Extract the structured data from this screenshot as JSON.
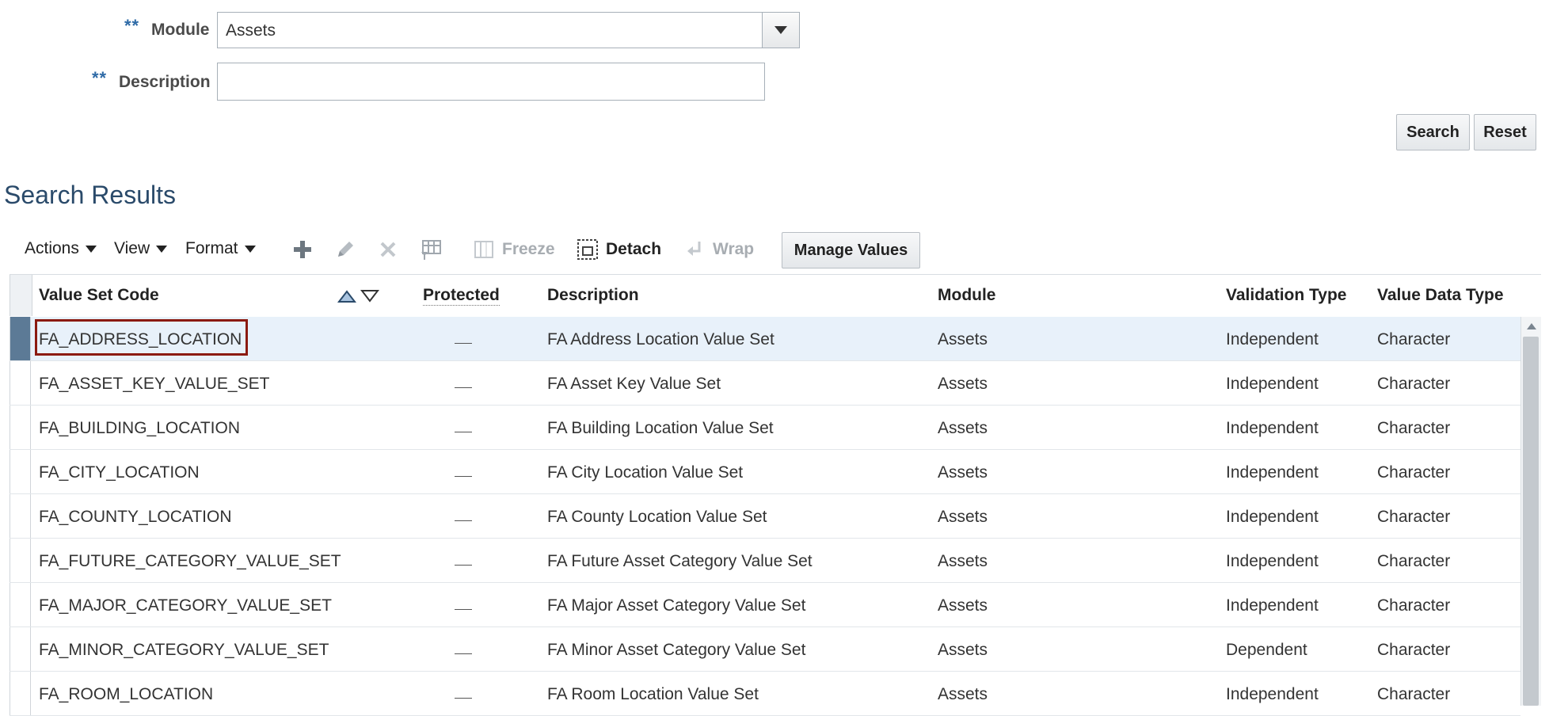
{
  "search_form": {
    "module_required_marker": "**",
    "module_label": "Module",
    "module_value": "Assets",
    "description_required_marker": "**",
    "description_label": "Description",
    "description_value": "",
    "search_button": "Search",
    "reset_button": "Reset"
  },
  "results": {
    "title": "Search Results",
    "toolbar": {
      "actions": "Actions",
      "view": "View",
      "format": "Format",
      "freeze": "Freeze",
      "detach": "Detach",
      "wrap": "Wrap",
      "manage_values": "Manage Values"
    },
    "columns": {
      "code": "Value Set Code",
      "protected": "Protected",
      "description": "Description",
      "module": "Module",
      "validation_type": "Validation Type",
      "data_type": "Value Data Type"
    },
    "rows": [
      {
        "code": "FA_ADDRESS_LOCATION",
        "protected": "—",
        "description": "FA Address Location Value Set",
        "module": "Assets",
        "validation_type": "Independent",
        "data_type": "Character"
      },
      {
        "code": "FA_ASSET_KEY_VALUE_SET",
        "protected": "—",
        "description": "FA Asset Key Value Set",
        "module": "Assets",
        "validation_type": "Independent",
        "data_type": "Character"
      },
      {
        "code": "FA_BUILDING_LOCATION",
        "protected": "—",
        "description": "FA Building Location Value Set",
        "module": "Assets",
        "validation_type": "Independent",
        "data_type": "Character"
      },
      {
        "code": "FA_CITY_LOCATION",
        "protected": "—",
        "description": "FA City Location Value Set",
        "module": "Assets",
        "validation_type": "Independent",
        "data_type": "Character"
      },
      {
        "code": "FA_COUNTY_LOCATION",
        "protected": "—",
        "description": "FA County Location Value Set",
        "module": "Assets",
        "validation_type": "Independent",
        "data_type": "Character"
      },
      {
        "code": "FA_FUTURE_CATEGORY_VALUE_SET",
        "protected": "—",
        "description": "FA Future Asset Category Value Set",
        "module": "Assets",
        "validation_type": "Independent",
        "data_type": "Character"
      },
      {
        "code": "FA_MAJOR_CATEGORY_VALUE_SET",
        "protected": "—",
        "description": "FA Major Asset Category Value Set",
        "module": "Assets",
        "validation_type": "Independent",
        "data_type": "Character"
      },
      {
        "code": "FA_MINOR_CATEGORY_VALUE_SET",
        "protected": "—",
        "description": "FA Minor Asset Category Value Set",
        "module": "Assets",
        "validation_type": "Dependent",
        "data_type": "Character"
      },
      {
        "code": "FA_ROOM_LOCATION",
        "protected": "—",
        "description": "FA Room Location Value Set",
        "module": "Assets",
        "validation_type": "Independent",
        "data_type": "Character"
      }
    ],
    "selected_row_index": 0
  },
  "colors": {
    "highlight_border": "#8b1a10",
    "selected_row_bg": "#e8f1fa",
    "required_marker": "#2e6aa6"
  }
}
